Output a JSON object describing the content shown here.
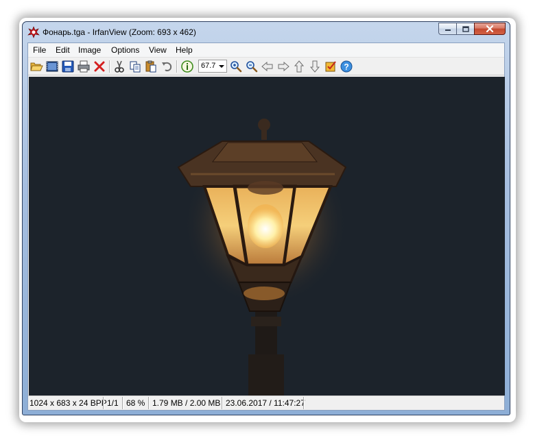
{
  "window": {
    "title": "Фонарь.tga - IrfanView (Zoom: 693 x 462)"
  },
  "menu": {
    "items": [
      "File",
      "Edit",
      "Image",
      "Options",
      "View",
      "Help"
    ]
  },
  "toolbar": {
    "icons": [
      "open-icon",
      "thumbnails-icon",
      "save-icon",
      "print-icon",
      "delete-icon",
      "cut-icon",
      "copy-icon",
      "paste-icon",
      "undo-icon",
      "info-icon",
      "zoom-in-icon",
      "zoom-out-icon",
      "previous-icon",
      "next-icon",
      "previous-file-icon",
      "next-file-icon",
      "properties-icon",
      "help-icon"
    ],
    "zoom_value": "67.7"
  },
  "image": {
    "subject": "street-lamp-photo"
  },
  "status": {
    "dimensions": "1024 x 683 x 24 BPP",
    "page": "1/1",
    "zoom_percent": "68 %",
    "memory": "1.79 MB / 2.00 MB",
    "datetime": "23.06.2017 / 11:47:27"
  },
  "colors": {
    "viewport_bg": "#1c232b",
    "title_bar": "#a7bfe0",
    "close_button": "#c44a30"
  }
}
